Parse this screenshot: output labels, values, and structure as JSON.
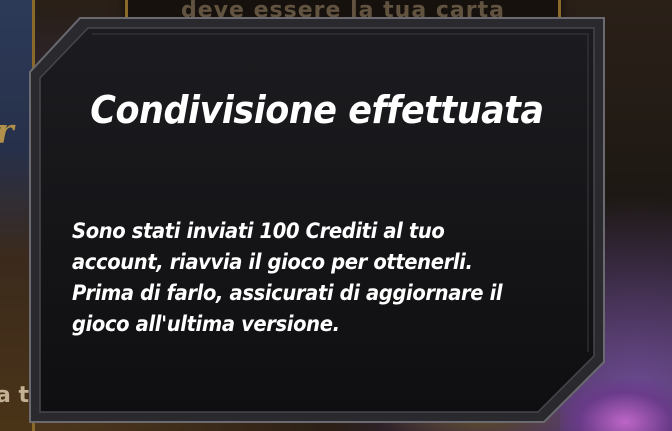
{
  "background": {
    "top_card_text": "deve essere la tua carta preferita.",
    "left_card_glyph": "Pr",
    "left_card_glyph2": "r",
    "bottom_left_text": "a tu"
  },
  "dialog": {
    "title": "Condivisione effettuata",
    "body": "Sono stati inviati 100 Crediti al tuo account, riavvia il gioco per ottenerli. Prima di farlo, assicurati di aggiornare il gioco all'ultima versione."
  },
  "colors": {
    "panel_fill": "#141416",
    "panel_border": "#5a5a60",
    "text": "#ffffff",
    "card_trim": "#8a6a2a"
  }
}
